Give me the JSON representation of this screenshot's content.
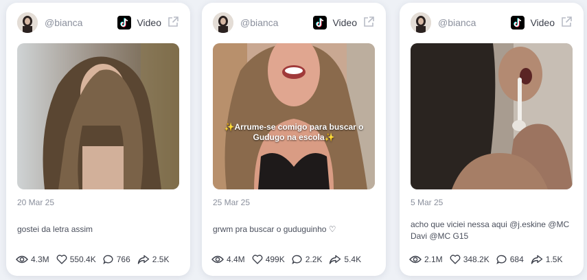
{
  "cards": [
    {
      "handle": "@bianca",
      "platform": "Video",
      "date": "20 Mar 25",
      "description": "gostei da letra assim",
      "overlay_text": "",
      "stats": {
        "views": "4.3M",
        "likes": "550.4K",
        "comments": "766",
        "shares": "2.5K"
      }
    },
    {
      "handle": "@bianca",
      "platform": "Video",
      "date": "25 Mar 25",
      "description": "grwm pra buscar o guduguinho ♡",
      "overlay_text": "✨Arrume-se comigo para buscar o Gudugo na escola✨",
      "stats": {
        "views": "4.4M",
        "likes": "499K",
        "comments": "2.2K",
        "shares": "5.4K"
      }
    },
    {
      "handle": "@bianca",
      "platform": "Video",
      "date": "5 Mar 25",
      "description": "acho que viciei nessa aqui @j.eskine @MC Davi @MC G15",
      "overlay_text": "",
      "stats": {
        "views": "2.1M",
        "likes": "348.2K",
        "comments": "684",
        "shares": "1.5K"
      }
    }
  ],
  "colors": {
    "page_bg": "#eef1f6",
    "card_bg": "#ffffff",
    "muted_text": "#8a8f9c",
    "body_text": "#3b3f4a"
  },
  "icons": [
    "tiktok-icon",
    "external-link-icon",
    "eye-icon",
    "heart-icon",
    "comment-icon",
    "share-icon"
  ]
}
